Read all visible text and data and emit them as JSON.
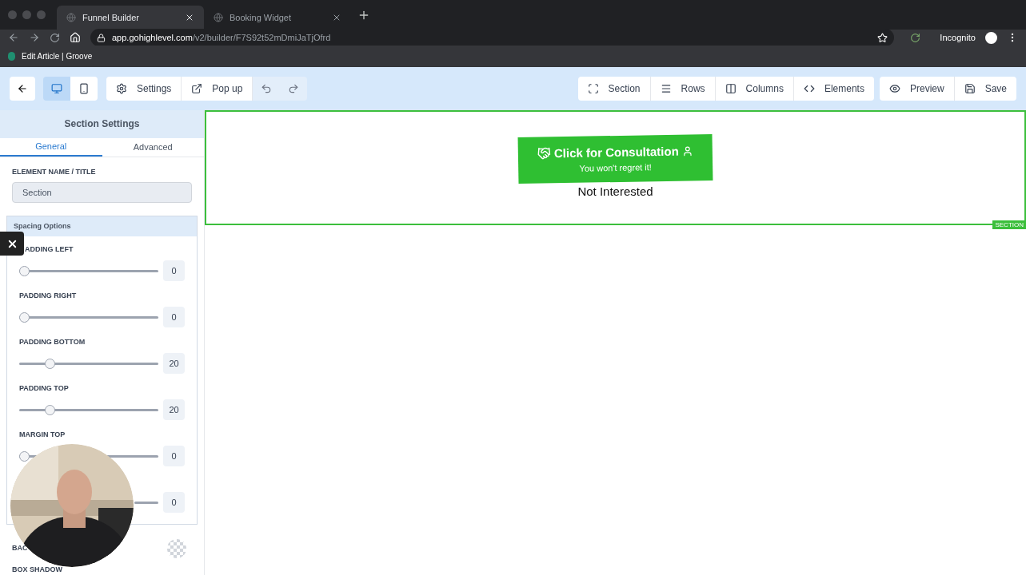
{
  "browser": {
    "tabs": [
      {
        "label": "Funnel Builder",
        "selected": true
      },
      {
        "label": "Booking Widget",
        "selected": false
      }
    ],
    "url_host": "app.gohighlevel.com",
    "url_path": "/v2/builder/F7S92t52mDmiJaTjOfrd",
    "profile": "Incognito",
    "bookmarks": [
      "Edit Article | Groove"
    ]
  },
  "toolbar": {
    "devices": [
      {
        "kind": "desktop",
        "selected": true
      },
      {
        "kind": "mobile",
        "selected": false
      }
    ],
    "left_buttons": [
      {
        "kind": "settings",
        "label": "Settings"
      },
      {
        "kind": "popup",
        "label": "Pop up"
      }
    ],
    "right_buttons": [
      {
        "kind": "section",
        "label": "Section"
      },
      {
        "kind": "rows",
        "label": "Rows"
      },
      {
        "kind": "columns",
        "label": "Columns"
      },
      {
        "kind": "elements",
        "label": "Elements"
      }
    ],
    "action_buttons": [
      {
        "kind": "preview",
        "label": "Preview"
      },
      {
        "kind": "save",
        "label": "Save"
      }
    ]
  },
  "panel": {
    "title": "Section Settings",
    "tabs": [
      {
        "label": "General",
        "selected": true
      },
      {
        "label": "Advanced",
        "selected": false
      }
    ],
    "name_label": "ELEMENT NAME / TITLE",
    "name_value": "Section",
    "spacing_title": "Spacing Options",
    "sliders": [
      {
        "label": "ADDING LEFT",
        "level": 0,
        "value": "0"
      },
      {
        "label": "PADDING RIGHT",
        "level": 0,
        "value": "0"
      },
      {
        "label": "PADDING BOTTOM",
        "level": 0.2,
        "value": "20"
      },
      {
        "label": "PADDING TOP",
        "level": 0.2,
        "value": "20"
      },
      {
        "label": "MARGIN TOP",
        "level": 0,
        "value": "0"
      },
      {
        "value": "0"
      }
    ],
    "background_label": "BAC",
    "box_shadow_label": "BOX SHADOW"
  },
  "canvas": {
    "button_title": "Click for Consultation",
    "button_subtitle": "You won't regret it!",
    "link": "Not Interested",
    "section_badge": "SECTION"
  }
}
